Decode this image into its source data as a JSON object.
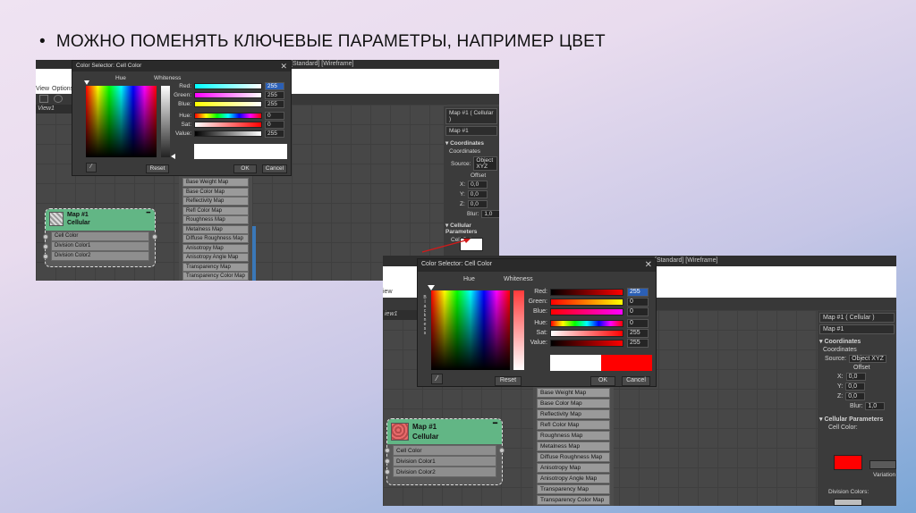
{
  "bullet": "МОЖНО ПОМЕНЯТЬ КЛЮЧЕВЫЕ ПАРАМЕТРЫ, НАПРИМЕР ЦВЕТ",
  "viewport_label": "[Standard] [Wireframe]",
  "menu": {
    "view": "View",
    "view_short": "iew",
    "options": "Options"
  },
  "view1": "View1",
  "view1_short": "iew1",
  "dialog": {
    "title": "Color Selector: Cell Color",
    "hue": "Hue",
    "whiteness": "Whiteness",
    "blackness": "Blackness",
    "labels": {
      "red": "Red:",
      "green": "Green:",
      "blue": "Blue:",
      "hue": "Hue:",
      "sat": "Sat:",
      "value": "Value:"
    },
    "reset": "Reset",
    "ok": "OK",
    "cancel": "Cancel"
  },
  "dlg1": {
    "red": "255",
    "green": "255",
    "blue": "255",
    "hue": "0",
    "sat": "0",
    "value": "255",
    "swatch_old": "#ffffff",
    "swatch_new": "#ffffff"
  },
  "dlg2": {
    "red": "255",
    "green": "0",
    "blue": "0",
    "hue": "0",
    "sat": "255",
    "value": "255",
    "swatch_old": "#ffffff",
    "swatch_new": "#ff0000"
  },
  "node": {
    "title": "Map #1",
    "subtitle": "Cellular",
    "rows": [
      "Cell Color",
      "Division Color1",
      "Division Color2"
    ]
  },
  "maps1": [
    "Base Weight Map",
    "Base Color Map",
    "Reflectivity Map",
    "Refl Color Map",
    "Roughness Map",
    "Metalness Map",
    "Diffuse Roughness Map",
    "Anisotropy Map",
    "Anisotropy Angle Map",
    "Transparency Map",
    "Transparency Color Map"
  ],
  "maps2": [
    "Base Weight Map",
    "Base Color Map",
    "Reflectivity Map",
    "Refl Color Map",
    "Roughness Map",
    "Metalness Map",
    "Diffuse Roughness Map",
    "Anisotropy Map",
    "Anisotropy Angle Map",
    "Transparency Map",
    "Transparency Color Map"
  ],
  "panel": {
    "header": "Map #1 ( Cellular )",
    "sub": "Map #1",
    "coordinates": "Coordinates",
    "coordinates_sub": "Coordinates",
    "source_label": "Source:",
    "source_value": "Object XYZ",
    "offset": "Offset",
    "x": "X:",
    "y": "Y:",
    "z": "Z:",
    "x_val": "0,0",
    "y_val": "0,0",
    "z_val": "0,0",
    "blur_label": "Blur:",
    "blur_val": "1,0",
    "cellular": "Cellular Parameters",
    "cell_color": "Cell Color:",
    "variation": "Variation",
    "division_colors": "Division Colors:"
  },
  "colors": {
    "cell_color_1": "#ffffff",
    "cell_color_2": "#ff0000",
    "node_green": "#62b685"
  }
}
